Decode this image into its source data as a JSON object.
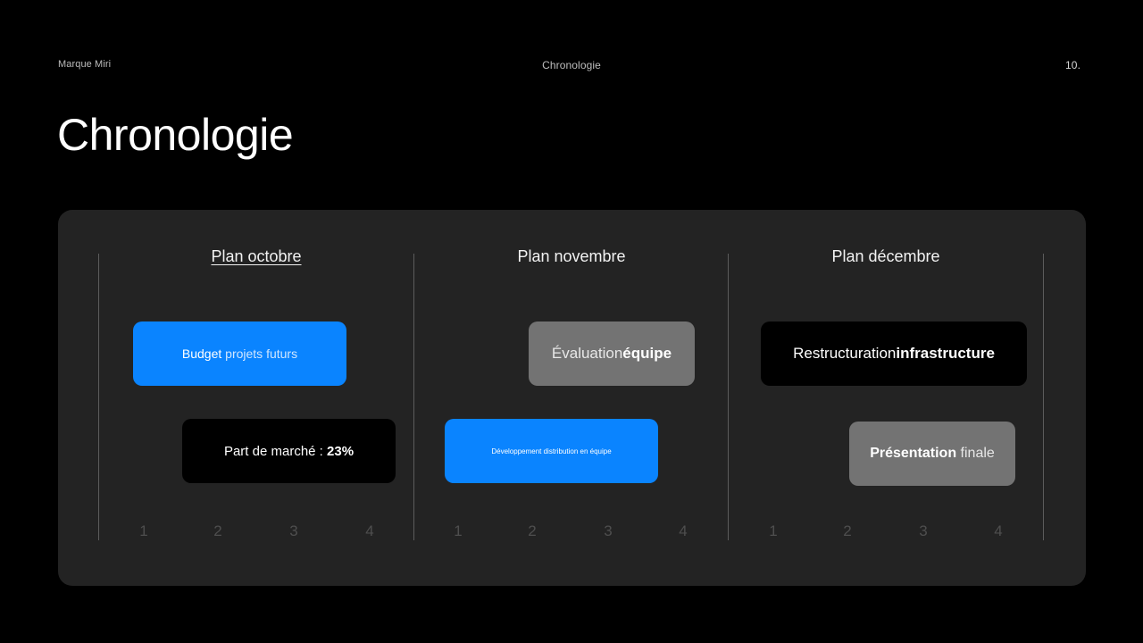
{
  "header": {
    "brand": "Marque Miri",
    "section": "Chronologie",
    "page_number": "10."
  },
  "page_title": "Chronologie",
  "months": [
    {
      "label": "Plan octobre"
    },
    {
      "label": "Plan novembre"
    },
    {
      "label": "Plan décembre"
    }
  ],
  "weeks": [
    "1",
    "2",
    "3",
    "4"
  ],
  "tasks": {
    "budget": {
      "part1": "Budget",
      "part2": " projets futurs"
    },
    "market": {
      "part1": "Part de marché : ",
      "part2": "23%"
    },
    "evaluation": {
      "part1": "Évaluation",
      "part2": "équipe"
    },
    "distribution": {
      "label": "Développement distribution en équipe"
    },
    "restructuration": {
      "part1": "Restructuration",
      "part2": "infrastructure"
    },
    "presentation": {
      "part1": "Présentation",
      "part2": " finale"
    }
  },
  "colors": {
    "background": "#000000",
    "panel": "#232323",
    "accent_blue": "#0a84ff",
    "grey_bar": "#737373"
  }
}
